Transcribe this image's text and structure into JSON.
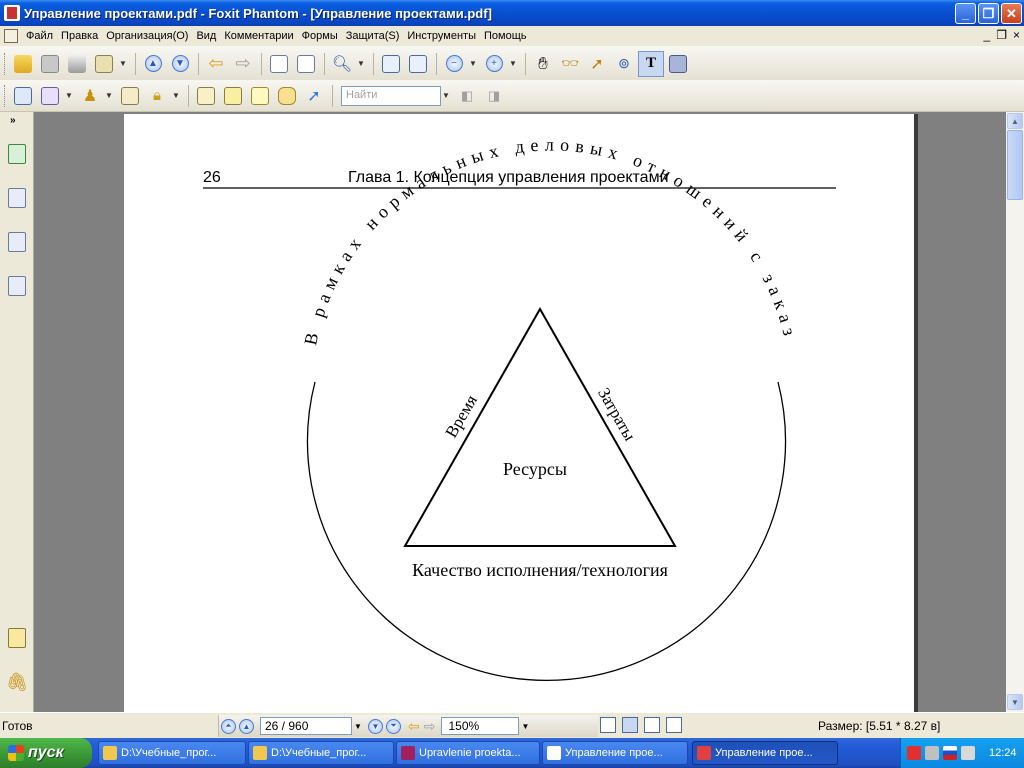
{
  "window": {
    "title": "Управление проектами.pdf - Foxit Phantom - [Управление проектами.pdf]",
    "minimize": "_",
    "restore": "❐",
    "close": "✕"
  },
  "menu": {
    "items": [
      "Файл",
      "Правка",
      "Организация(O)",
      "Вид",
      "Комментарии",
      "Формы",
      "Защита(S)",
      "Инструменты",
      "Помощь"
    ],
    "mdi_minimize": "_",
    "mdi_restore": "❐",
    "mdi_close": "×"
  },
  "toolbar": {
    "find_placeholder": "Найти"
  },
  "document": {
    "page_number": "26",
    "running_head": "Глава 1. Концепция управления проектами",
    "arc_text": "В рамках нормальных деловых отношений с заказчиком",
    "side_left": "Время",
    "side_right": "Затраты",
    "center": "Ресурсы",
    "bottom": "Качество исполнения/технология"
  },
  "status": {
    "ready": "Готов",
    "page_field": "26 / 960",
    "zoom_field": "150%",
    "size": "Размер: [5.51 * 8.27 в]"
  },
  "taskbar": {
    "start": "пуск",
    "tasks": [
      "D:\\Учебные_прог...",
      "D:\\Учебные_прог...",
      "Upravlenie proekta...",
      "Управление прое...",
      "Управление прое..."
    ],
    "clock": "12:24"
  }
}
